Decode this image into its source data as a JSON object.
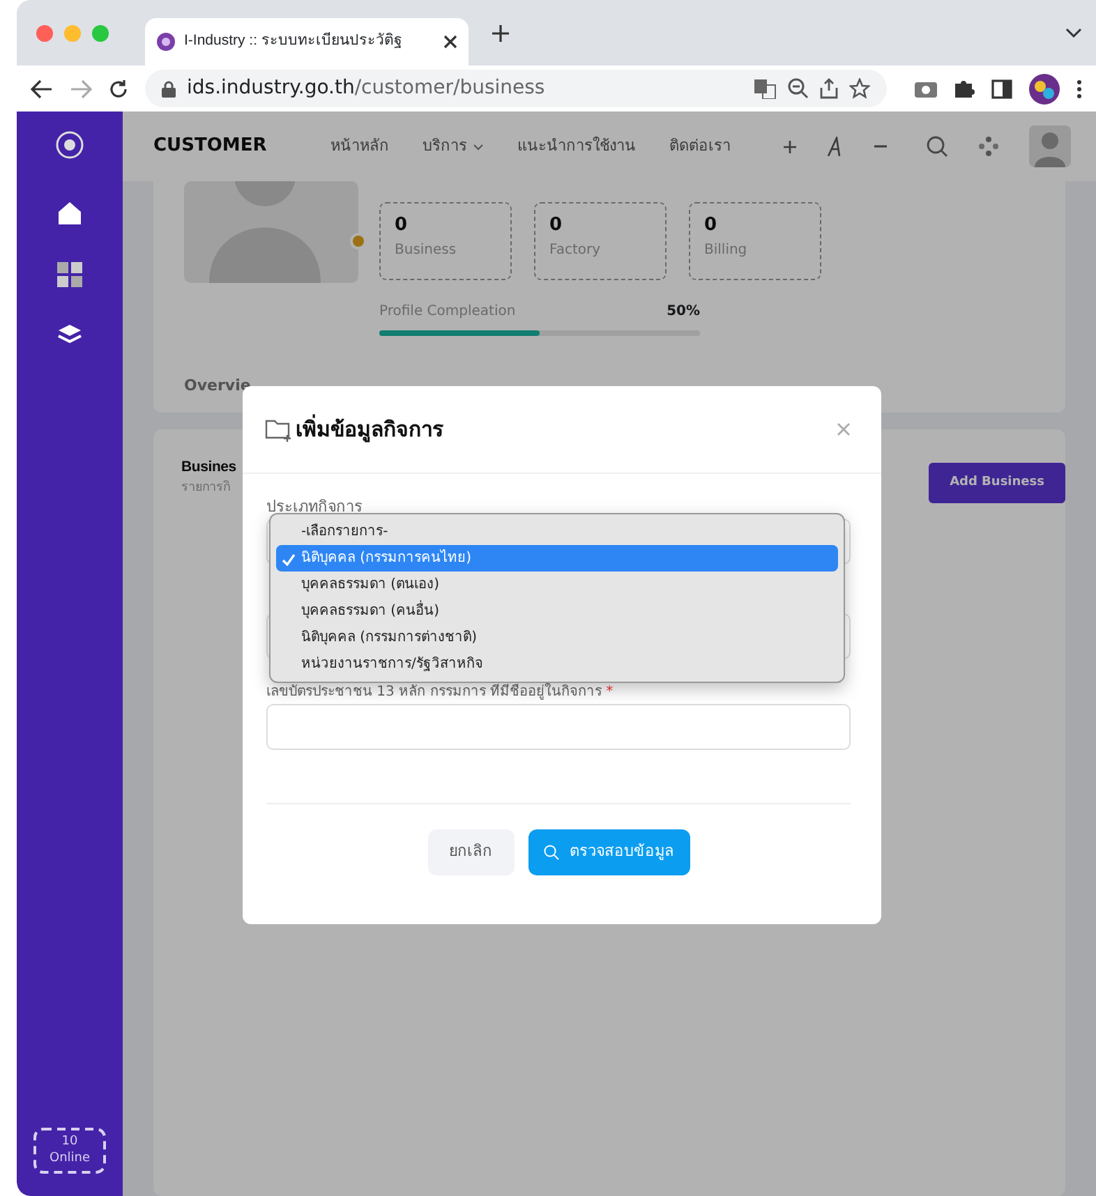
{
  "browser": {
    "tab_title": "I-Industry :: ระบบทะเบียนประวัติฐ",
    "url_host": "ids.industry.go.th",
    "url_path": "/customer/business"
  },
  "sidebar": {
    "online": {
      "count": "10",
      "label": "Online"
    }
  },
  "header": {
    "brand": "CUSTOMER",
    "nav": [
      {
        "label": "หน้าหลัก",
        "dropdown": false
      },
      {
        "label": "บริการ",
        "dropdown": true
      },
      {
        "label": "แนะนำการใช้งาน",
        "dropdown": false
      },
      {
        "label": "ติดต่อเรา",
        "dropdown": false
      }
    ]
  },
  "profile": {
    "stats": [
      {
        "value": "0",
        "label": "Business"
      },
      {
        "value": "0",
        "label": "Factory"
      },
      {
        "value": "0",
        "label": "Billing"
      }
    ],
    "progress": {
      "label": "Profile Compleation",
      "reading": "50%",
      "level": 0.5
    },
    "tabs": [
      {
        "label": "Overvie",
        "selected": false
      }
    ]
  },
  "business": {
    "title": "Busines",
    "subtitle": "รายการกิ",
    "button": "Add Business"
  },
  "modal": {
    "title": "เพิ่มข้อมูลกิจการ",
    "type_label": "ประเภทกิจการ",
    "options": [
      {
        "label": "-เลือกรายการ-",
        "selected": false
      },
      {
        "label": "นิติบุคคล (กรรมการคนไทย)",
        "selected": true
      },
      {
        "label": "บุคคลธรรมดา (ตนเอง)",
        "selected": false
      },
      {
        "label": "บุคคลธรรมดา (คนอื่น)",
        "selected": false
      },
      {
        "label": "นิติบุคคล (กรรมการต่างชาติ)",
        "selected": false
      },
      {
        "label": "หน่วยงานราชการ/รัฐวิสาหกิจ",
        "selected": false
      }
    ],
    "id_label": "เลขบัตรประชาชน 13 หลัก กรรมการ ที่มีชื่ออยู่ในกิจการ",
    "id_required_mark": "*",
    "cancel": "ยกเลิก",
    "submit": "ตรวจสอบข้อมูล"
  }
}
